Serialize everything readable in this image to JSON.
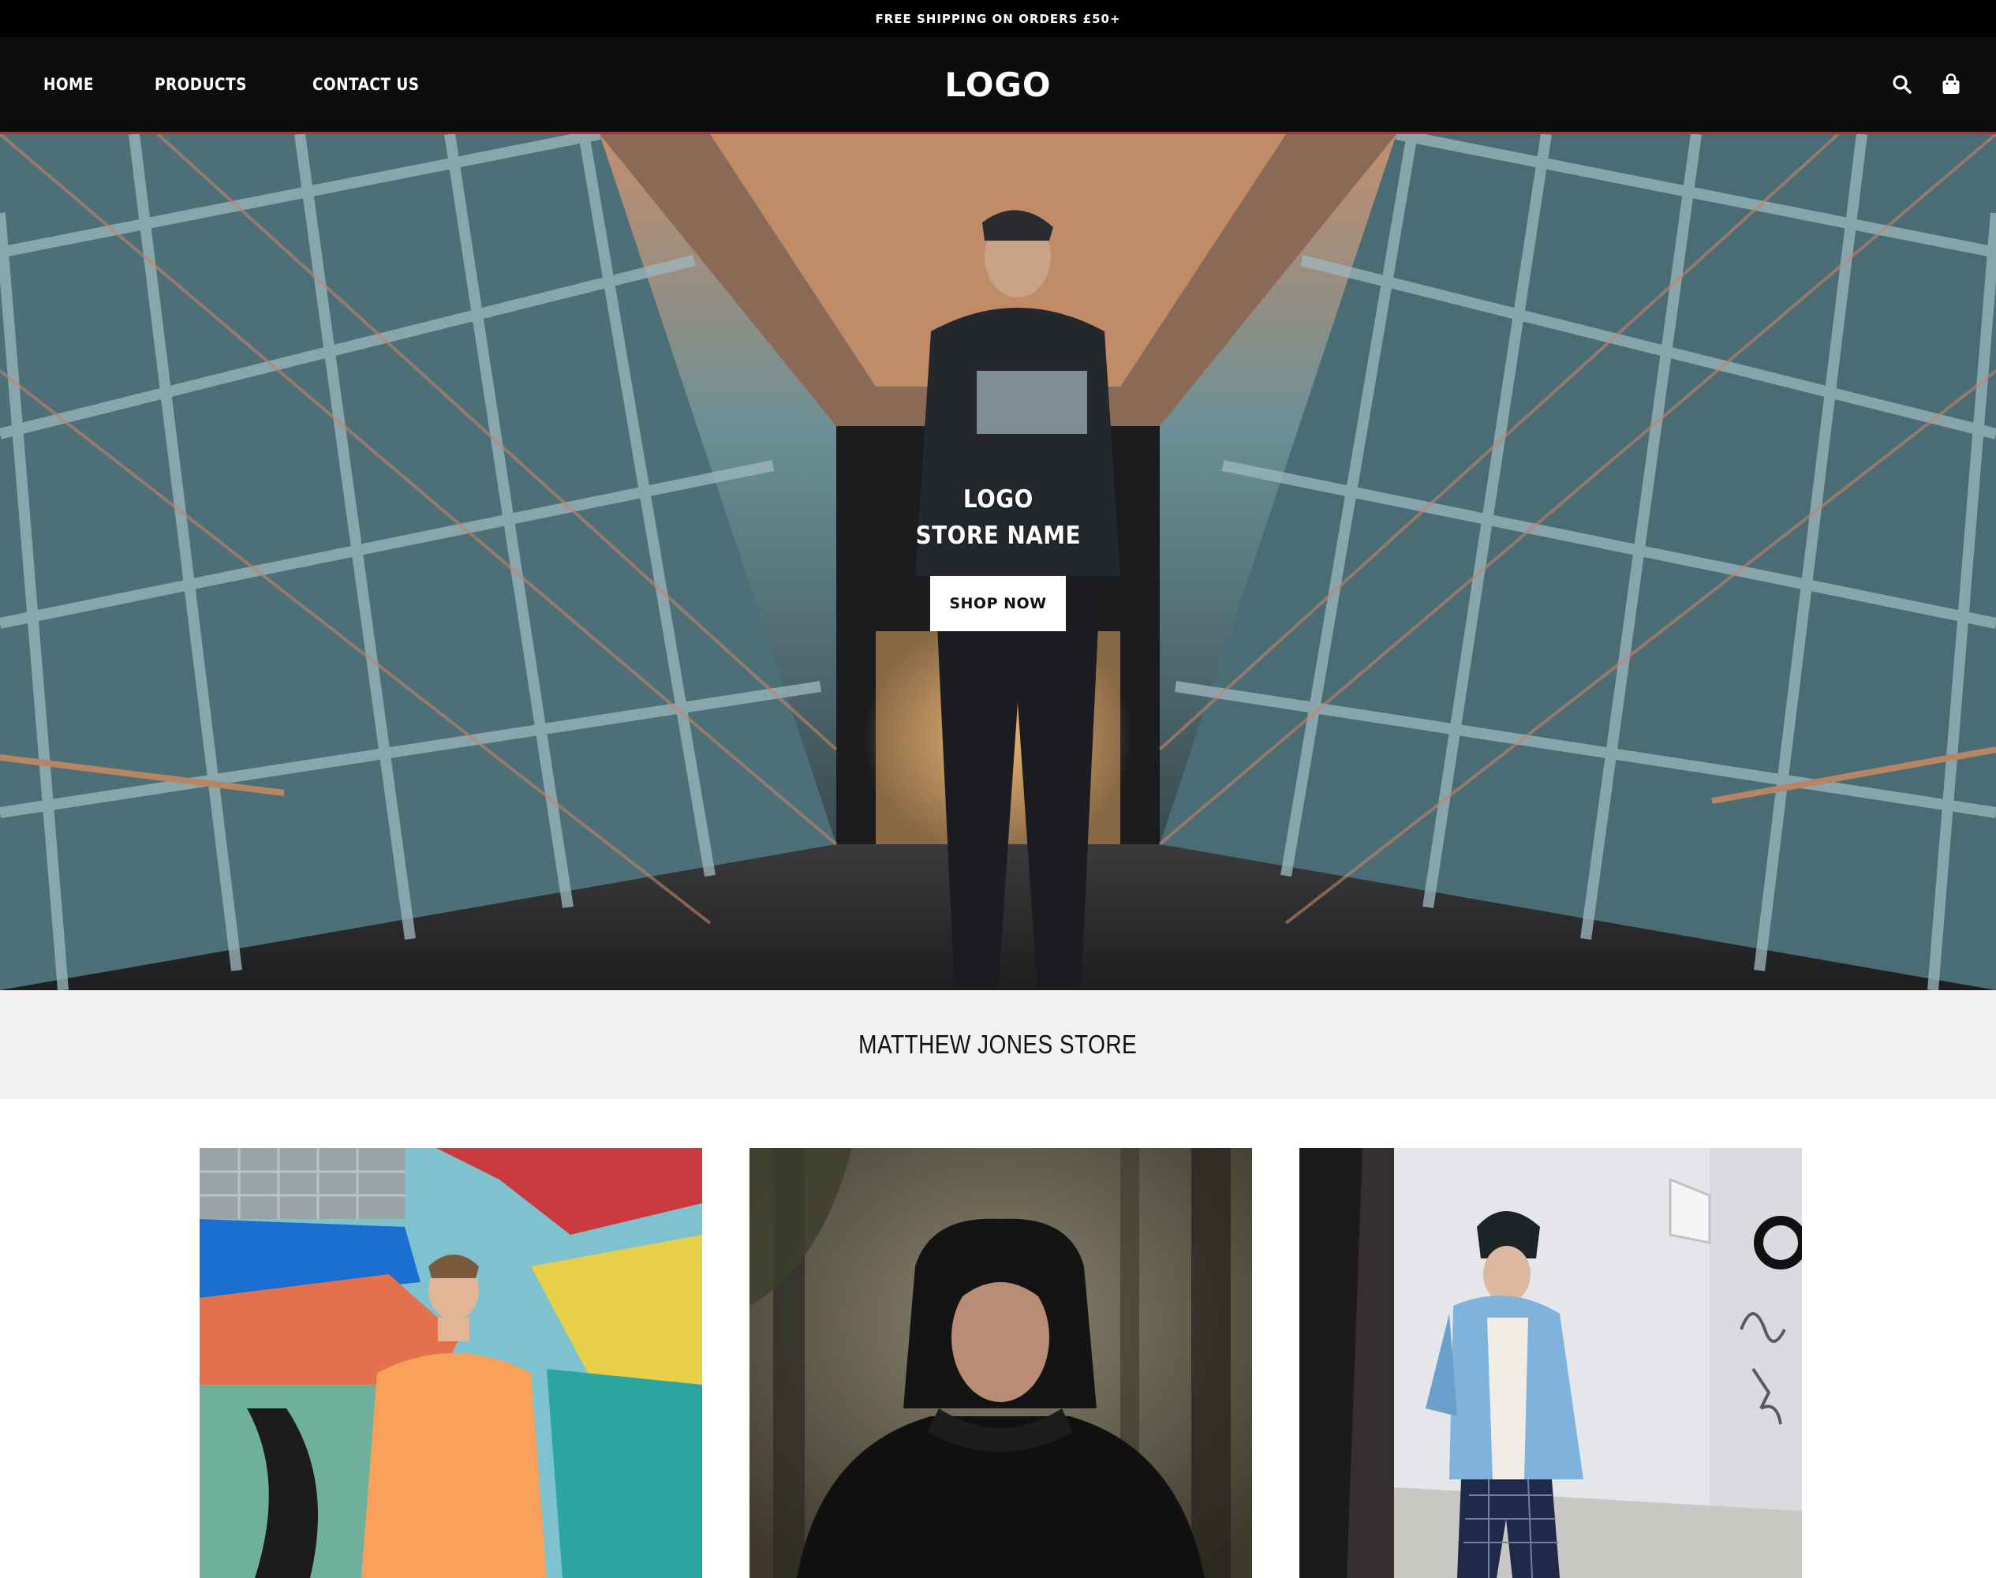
{
  "announcement": {
    "text": "FREE SHIPPING ON ORDERS £50+"
  },
  "header": {
    "nav": [
      {
        "label": "HOME"
      },
      {
        "label": "PRODUCTS"
      },
      {
        "label": "CONTACT US"
      }
    ],
    "logo": "LOGO",
    "icons": {
      "search": "search-icon",
      "cart": "shopping-bag-icon"
    },
    "accent_color": "#d0202a"
  },
  "hero": {
    "title_line1": "LOGO",
    "title_line2": "STORE NAME",
    "cta_label": "SHOP NOW",
    "image": "man-in-glass-walkway-photo"
  },
  "store_band": {
    "title": "MATTHEW JONES STORE"
  },
  "products": [
    {
      "image": "man-orange-sweatshirt-graffiti-wall-photo"
    },
    {
      "image": "man-black-hoodie-forest-photo"
    },
    {
      "image": "man-denim-jacket-beanie-street-photo"
    }
  ]
}
